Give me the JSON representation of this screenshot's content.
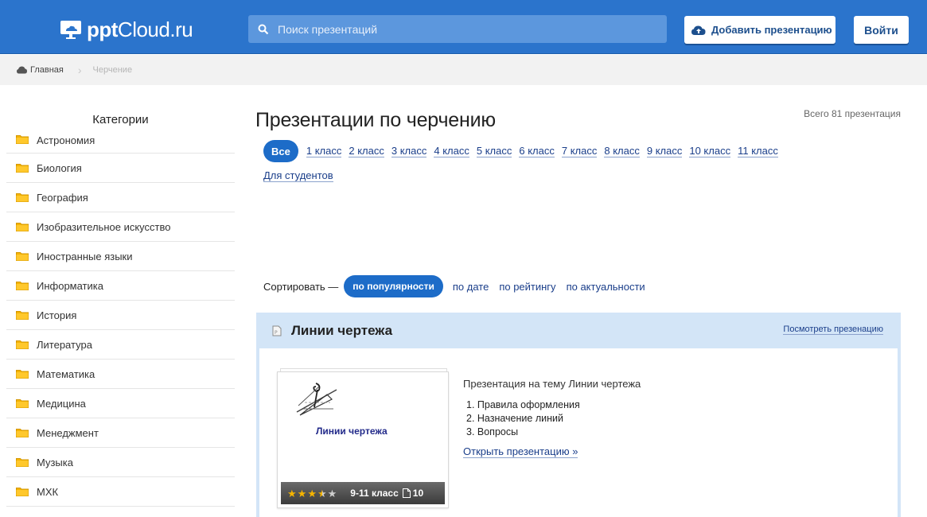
{
  "header": {
    "logo_ppt": "ppt",
    "logo_rest": "Cloud.ru",
    "search_placeholder": "Поиск презентаций",
    "add_label": "Добавить презентацию",
    "login_label": "Войти",
    "brand_color": "#2b74cc"
  },
  "breadcrumb": {
    "home": "Главная",
    "separator": "›",
    "current": "Черчение"
  },
  "sidebar": {
    "title": "Категории",
    "items": [
      {
        "label": "Астрономия"
      },
      {
        "label": "Биология"
      },
      {
        "label": "География"
      },
      {
        "label": "Изобразительное искусство"
      },
      {
        "label": "Иностранные языки"
      },
      {
        "label": "Информатика"
      },
      {
        "label": "История"
      },
      {
        "label": "Литература"
      },
      {
        "label": "Математика"
      },
      {
        "label": "Медицина"
      },
      {
        "label": "Менеджмент"
      },
      {
        "label": "Музыка"
      },
      {
        "label": "МХК"
      }
    ]
  },
  "main": {
    "title": "Презентации по черчению",
    "total": "Всего 81 презентация",
    "filter_all": "Все",
    "classes": [
      "1 класс",
      "2 класс",
      "3 класс",
      "4 класс",
      "5 класс",
      "6 класс",
      "7 класс",
      "8 класс",
      "9 класс",
      "10 класс",
      "11 класс"
    ],
    "students": "Для студентов",
    "sort": {
      "label": "Сортировать —",
      "active": "по популярности",
      "options": [
        "по дате",
        "по рейтингу",
        "по актуальности"
      ]
    }
  },
  "card": {
    "title": "Линии чертежа",
    "view_link": "Посмотреть презенацию",
    "thumb_caption": "Линии чертежа",
    "rating_stars": 3.5,
    "rating_max": 5,
    "grade": "9-11 класс",
    "pages": "10",
    "desc": "Презентация на тему Линии чертежа",
    "points": [
      "1. Правила оформления",
      "2. Назначение линий",
      "3. Вопросы"
    ],
    "open_link": "Открыть презентацию »"
  }
}
